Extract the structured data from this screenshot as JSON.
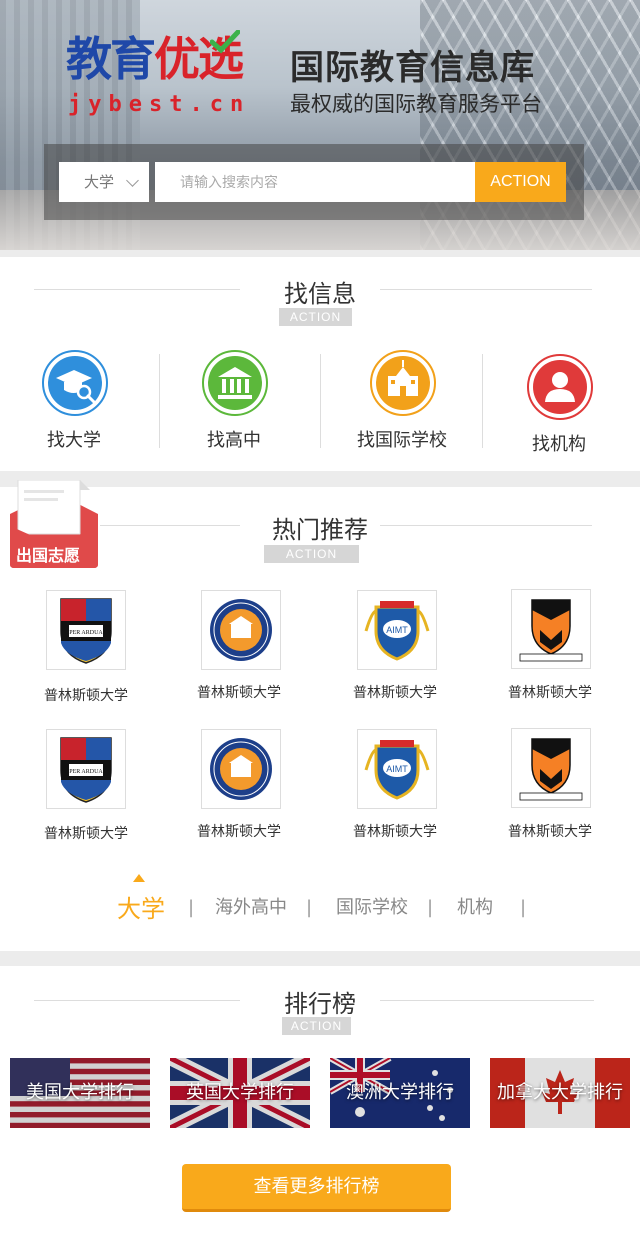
{
  "header": {
    "logo_cn_part1": "教育",
    "logo_cn_part2": "优选",
    "logo_en": "jybest.cn",
    "slogan_main": "国际教育信息库",
    "slogan_sub": "最权威的国际教育服务平台",
    "brand_blue": "#1f48a8",
    "brand_red": "#d9232a"
  },
  "search": {
    "select_value": "大学",
    "placeholder": "请输入搜索内容",
    "button_label": "ACTION",
    "accent_color": "#f9a91b"
  },
  "find_info": {
    "title": "找信息",
    "badge": "ACTION",
    "items": [
      {
        "label": "找大学",
        "icon": "graduation-cap-search-icon",
        "color": "#2f8fdc"
      },
      {
        "label": "找高中",
        "icon": "building-columns-icon",
        "color": "#5cb83b"
      },
      {
        "label": "找国际学校",
        "icon": "school-building-icon",
        "color": "#f2a11a"
      },
      {
        "label": "找机构",
        "icon": "person-icon",
        "color": "#e03a3a"
      }
    ]
  },
  "hot": {
    "title": "热门推荐",
    "badge": "ACTION",
    "ribbon_label": "出国志愿",
    "universities": [
      {
        "name": "普林斯顿大学",
        "logo": "birmingham-crest-icon"
      },
      {
        "name": "普林斯顿大学",
        "logo": "virginia-seal-icon"
      },
      {
        "name": "普林斯顿大学",
        "logo": "aimt-crest-icon"
      },
      {
        "name": "普林斯顿大学",
        "logo": "princeton-shield-icon"
      },
      {
        "name": "普林斯顿大学",
        "logo": "birmingham-crest-icon"
      },
      {
        "name": "普林斯顿大学",
        "logo": "virginia-seal-icon"
      },
      {
        "name": "普林斯顿大学",
        "logo": "aimt-crest-icon"
      },
      {
        "name": "普林斯顿大学",
        "logo": "princeton-shield-icon"
      }
    ],
    "tabs": [
      "大学",
      "海外高中",
      "国际学校",
      "机构"
    ],
    "separator": "|"
  },
  "ranking": {
    "title": "排行榜",
    "badge": "ACTION",
    "flags": [
      {
        "label": "美国大学排行",
        "flag": "usa-flag"
      },
      {
        "label": "英国大学排行",
        "flag": "uk-flag"
      },
      {
        "label": "澳洲大学排行",
        "flag": "australia-flag"
      },
      {
        "label": "加拿大大学排行",
        "flag": "canada-flag"
      }
    ],
    "more_button": "查看更多排行榜"
  }
}
